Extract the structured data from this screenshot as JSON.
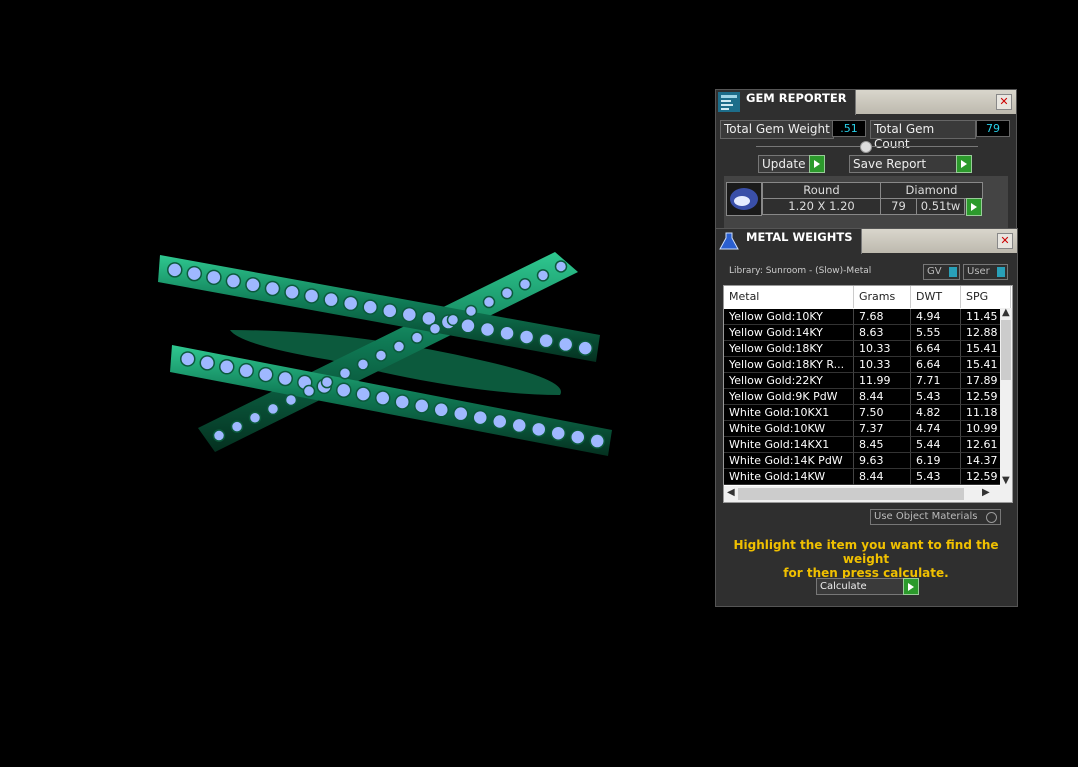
{
  "gem_reporter": {
    "title": "GEM REPORTER",
    "total_gem_weight_label": "Total Gem Weight",
    "total_gem_weight": ".51",
    "total_gem_count_label": "Total Gem Count",
    "total_gem_count": "79",
    "update_label": "Update",
    "save_report_label": "Save Report",
    "gem_row": {
      "shape": "Round",
      "type": "Diamond",
      "size": "1.20 X 1.20",
      "count": "79",
      "weight": "0.51tw"
    }
  },
  "metal_weights": {
    "title": "METAL WEIGHTS",
    "library": "Library: Sunroom - (Slow)-Metal",
    "gv_label": "GV",
    "user_label": "User",
    "columns": [
      "Metal",
      "Grams",
      "DWT",
      "SPG"
    ],
    "rows": [
      {
        "metal": "Yellow Gold:10KY",
        "grams": "7.68",
        "dwt": "4.94",
        "spg": "11.45"
      },
      {
        "metal": "Yellow Gold:14KY",
        "grams": "8.63",
        "dwt": "5.55",
        "spg": "12.88"
      },
      {
        "metal": "Yellow Gold:18KY",
        "grams": "10.33",
        "dwt": "6.64",
        "spg": "15.41"
      },
      {
        "metal": "Yellow Gold:18KY R...",
        "grams": "10.33",
        "dwt": "6.64",
        "spg": "15.41"
      },
      {
        "metal": "Yellow Gold:22KY",
        "grams": "11.99",
        "dwt": "7.71",
        "spg": "17.89"
      },
      {
        "metal": "Yellow Gold:9K PdW",
        "grams": "8.44",
        "dwt": "5.43",
        "spg": "12.59"
      },
      {
        "metal": "White Gold:10KX1",
        "grams": "7.50",
        "dwt": "4.82",
        "spg": "11.18"
      },
      {
        "metal": "White Gold:10KW",
        "grams": "7.37",
        "dwt": "4.74",
        "spg": "10.99"
      },
      {
        "metal": "White Gold:14KX1",
        "grams": "8.45",
        "dwt": "5.44",
        "spg": "12.61"
      },
      {
        "metal": "White Gold:14K PdW",
        "grams": "9.63",
        "dwt": "6.19",
        "spg": "14.37"
      },
      {
        "metal": "White Gold:14KW",
        "grams": "8.44",
        "dwt": "5.43",
        "spg": "12.59"
      }
    ],
    "use_object_materials_label": "Use Object Materials",
    "hint_line1": "Highlight the item you want to find the weight",
    "hint_line2": "for then press calculate.",
    "calculate_label": "Calculate"
  },
  "colors": {
    "ring_green": "#1a9a6c",
    "gem_blue": "#9fb8ff",
    "accent_cyan": "#29d0e8",
    "hint_yellow": "#f0c000"
  }
}
